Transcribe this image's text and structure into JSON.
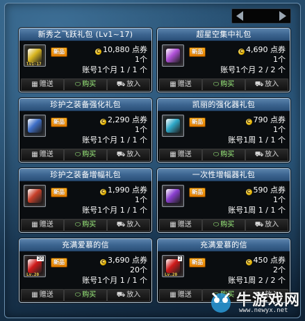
{
  "pager": {
    "prev_icon": "chevron-left-icon",
    "next_icon": "chevron-right-icon"
  },
  "badge_label": "新品",
  "buttons": {
    "gift": "赠送",
    "buy": "购买",
    "cart": "放入"
  },
  "cards": [
    {
      "title": "新秀之飞跃礼包 (Lv1~17)",
      "price": "10,880 点券",
      "qty": "1个",
      "limit": "账号1个月 1 / 1 个",
      "icon": "levelup-box-icon",
      "icon_color": "#d8b520",
      "icon_lv": "lv1~17",
      "icon_count": ""
    },
    {
      "title": "超星空集中礼包",
      "price": "4,690 点券",
      "qty": "1个",
      "limit": "账号1个月 2 / 2 个",
      "icon": "star-chest-icon",
      "icon_color": "#b050d8",
      "icon_lv": "",
      "icon_count": ""
    },
    {
      "title": "珍护之装备强化礼包",
      "price": "2,290 点券",
      "qty": "1个",
      "limit": "账号1个月 1 / 1 个",
      "icon": "enhance-scroll-icon",
      "icon_color": "#3f6fc8",
      "icon_lv": "",
      "icon_count": ""
    },
    {
      "title": "凯丽的强化器礼包",
      "price": "790 点券",
      "qty": "1个",
      "limit": "账号1周 1 / 1 个",
      "icon": "enhancer-box-icon",
      "icon_color": "#2fa8c8",
      "icon_lv": "",
      "icon_count": ""
    },
    {
      "title": "珍护之装备增幅礼包",
      "price": "1,990 点券",
      "qty": "1个",
      "limit": "账号1个月 1 / 1 个",
      "icon": "amplify-scroll-icon",
      "icon_color": "#c8402a",
      "icon_lv": "",
      "icon_count": ""
    },
    {
      "title": "一次性增幅器礼包",
      "price": "590 点券",
      "qty": "1个",
      "limit": "账号1周 1 / 1 个",
      "icon": "amplifier-box-icon",
      "icon_color": "#8a3fd0",
      "icon_lv": "",
      "icon_count": ""
    },
    {
      "title": "充满爱慕的信",
      "price": "3,690 点券",
      "qty": "20个",
      "limit": "账号1个月 1 / 1 个",
      "icon": "love-letter-icon",
      "icon_color": "#d01a1a",
      "icon_lv": "Lv.20",
      "icon_count": "20"
    },
    {
      "title": "充满爱慕的信",
      "price": "450 点券",
      "qty": "2个",
      "limit": "账号1周 2 / 2 个",
      "icon": "love-letter-icon",
      "icon_color": "#d01a1a",
      "icon_lv": "Lv.20",
      "icon_count": "2"
    }
  ],
  "watermark": {
    "main": "牛游戏网",
    "url": "www.newyx.net"
  }
}
